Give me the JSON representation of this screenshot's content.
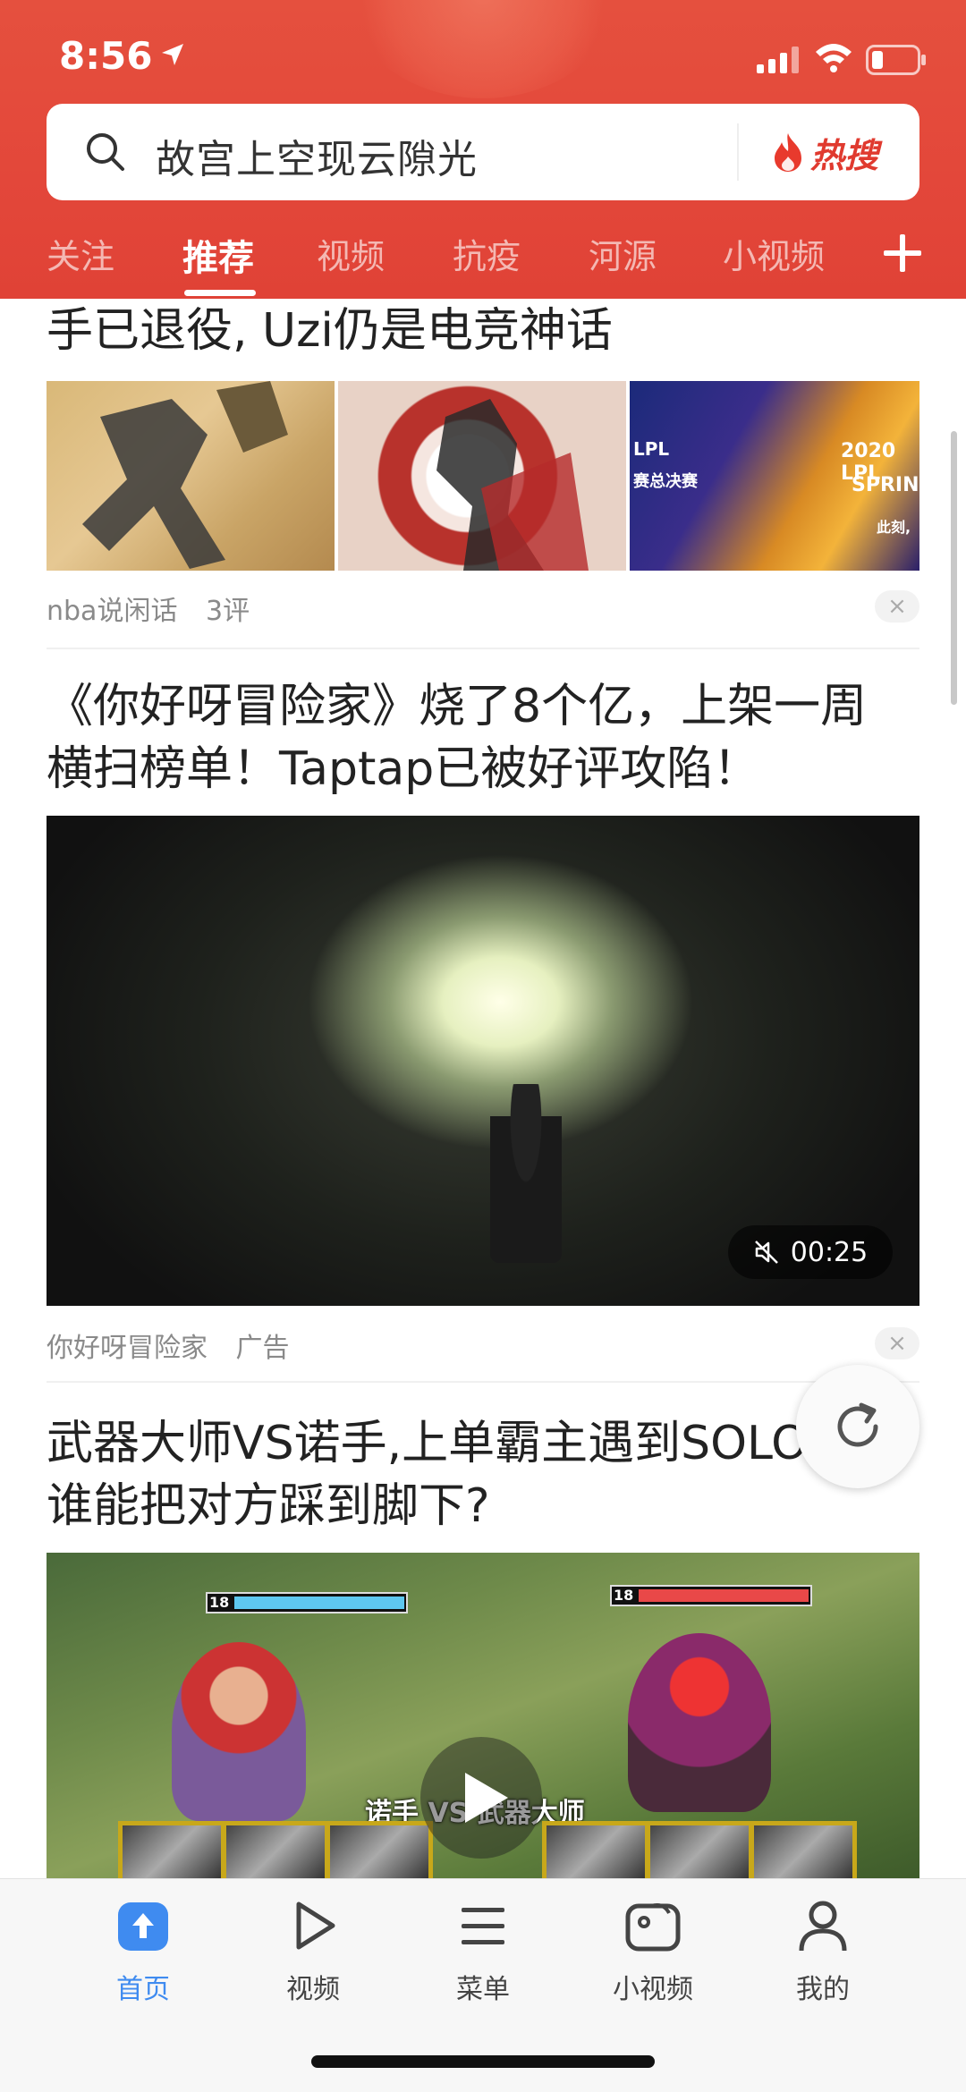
{
  "status_bar": {
    "time": "8:56"
  },
  "search": {
    "query": "故宫上空现云隙光",
    "hot_label": "热搜"
  },
  "tabs": [
    "关注",
    "推荐",
    "视频",
    "抗疫",
    "河源",
    "小视频"
  ],
  "active_tab": "推荐",
  "feed": {
    "item1": {
      "title": "手已退役, Uzi仍是电竞神话",
      "image3_texts": [
        "LPL",
        "赛总决赛",
        "2020 LPL",
        "SPRIN",
        "此刻,"
      ],
      "source": "nba说闲话",
      "comments": "3评"
    },
    "item2": {
      "title_line1": "《你好呀冒险家》烧了8个亿，上架一周",
      "title_line2": "横扫榜单！Taptap已被好评攻陷！",
      "duration": "00:25",
      "source": "你好呀冒险家",
      "tag": "广告"
    },
    "item3": {
      "title_line1": "武器大师VS诺手,上单霸主遇到SOLO王,",
      "title_line2": "谁能把对方踩到脚下?",
      "left_level": "18",
      "right_level": "18",
      "overlay_text": "诺手 VS 武器大师"
    },
    "close_label": "×"
  },
  "bottom_nav": [
    {
      "label": "首页",
      "icon": "home-icon"
    },
    {
      "label": "视频",
      "icon": "play-icon"
    },
    {
      "label": "菜单",
      "icon": "menu-icon"
    },
    {
      "label": "小视频",
      "icon": "camera-icon"
    },
    {
      "label": "我的",
      "icon": "person-icon"
    }
  ],
  "colors": {
    "header_red": "#e3473a",
    "active_blue": "#3f8bf0",
    "hot_red": "#e03a2f"
  }
}
